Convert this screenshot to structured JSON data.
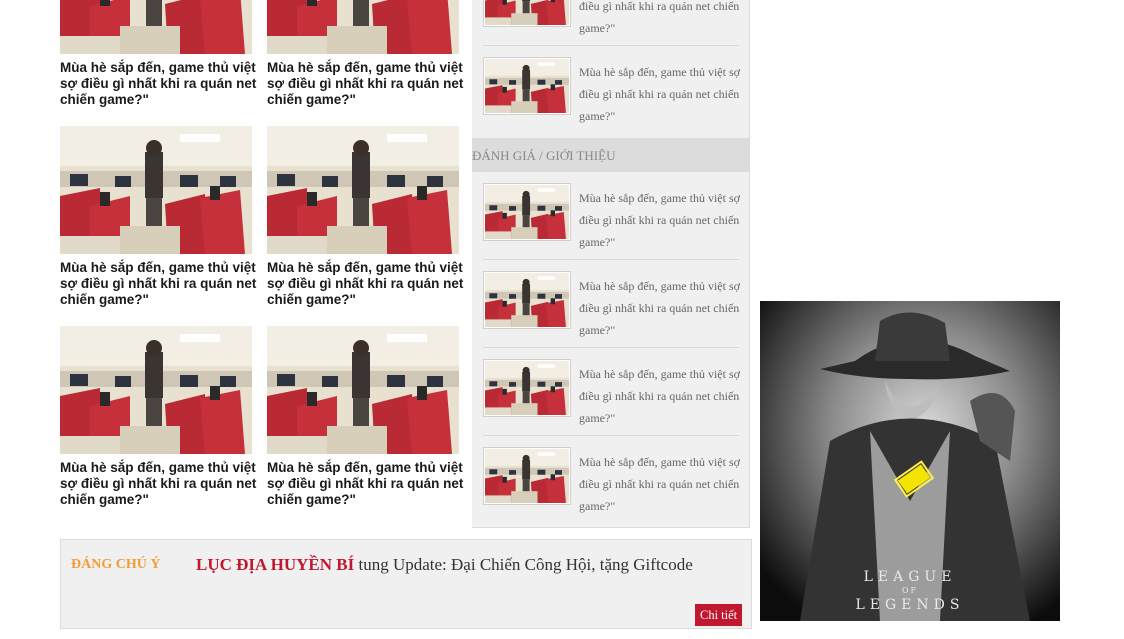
{
  "article_title": "Mùa hè sắp đến, game thủ việt sợ điều gì nhất khi ra quán net chiến game?\"",
  "grid": {
    "items": [
      {
        "title": "Mùa hè sắp đến, game thủ việt sợ điều gì nhất khi ra quán net chiến game?\""
      },
      {
        "title": "Mùa hè sắp đến, game thủ việt sợ điều gì nhất khi ra quán net chiến game?\""
      },
      {
        "title": "Mùa hè sắp đến, game thủ việt sợ điều gì nhất khi ra quán net chiến game?\""
      },
      {
        "title": "Mùa hè sắp đến, game thủ việt sợ điều gì nhất khi ra quán net chiến game?\""
      },
      {
        "title": "Mùa hè sắp đến, game thủ việt sợ điều gì nhất khi ra quán net chiến game?\""
      },
      {
        "title": "Mùa hè sắp đến, game thủ việt sợ điều gì nhất khi ra quán net chiến game?\""
      }
    ]
  },
  "sidebar": {
    "top_items": [
      {
        "title": "Mùa hè sắp đến, game thủ việt sợ điều gì nhất khi ra quán net chiến game?\""
      },
      {
        "title": "Mùa hè sắp đến, game thủ việt sợ điều gì nhất khi ra quán net chiến game?\""
      }
    ],
    "heading": "ĐÁNH GIÁ / GIỚI THIỆU",
    "review_items": [
      {
        "title": "Mùa hè sắp đến, game thủ việt sợ điều gì nhất khi ra quán net chiến game?\""
      },
      {
        "title": "Mùa hè sắp đến, game thủ việt sợ điều gì nhất khi ra quán net chiến game?\""
      },
      {
        "title": "Mùa hè sắp đến, game thủ việt sợ điều gì nhất khi ra quán net chiến game?\""
      },
      {
        "title": "Mùa hè sắp đến, game thủ việt sợ điều gì nhất khi ra quán net chiến game?\""
      }
    ]
  },
  "notice": {
    "label": "ĐÁNG CHÚ Ý",
    "highlight": "LỤC ĐỊA HUYỀN BÍ",
    "text": " tung Update: Đại Chiến Công Hội, tặng Giftcode",
    "button": "Chi tiết"
  },
  "ad": {
    "logo_line1": "LEAGUE",
    "logo_line2": "OF",
    "logo_line3": "LEGENDS"
  },
  "colors": {
    "accent_red": "#c0182f",
    "accent_orange": "#f39c33",
    "sidebar_bg": "#f0f0f0"
  }
}
